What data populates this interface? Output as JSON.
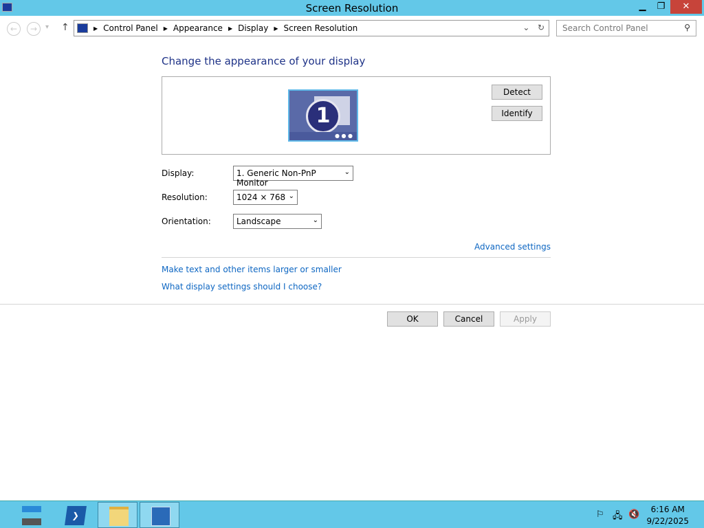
{
  "window": {
    "title": "Screen Resolution",
    "minimize": "▁",
    "restore": "❐",
    "close": "✕"
  },
  "nav": {
    "back": "←",
    "forward": "→",
    "recent": "▾",
    "up": "↑",
    "breadcrumbs": [
      "Control Panel",
      "Appearance",
      "Display",
      "Screen Resolution"
    ],
    "dropdown": "⌄",
    "refresh": "↻",
    "search_placeholder": "Search Control Panel",
    "search_icon": "⚲"
  },
  "main": {
    "heading": "Change the appearance of your display",
    "monitor_number": "1",
    "detect": "Detect",
    "identify": "Identify",
    "display_label": "Display:",
    "display_value": "1. Generic Non-PnP Monitor",
    "resolution_label": "Resolution:",
    "resolution_value": "1024 × 768",
    "orientation_label": "Orientation:",
    "orientation_value": "Landscape",
    "advanced": "Advanced settings",
    "link_text_size": "Make text and other items larger or smaller",
    "link_help": "What display settings should I choose?",
    "ok": "OK",
    "cancel": "Cancel",
    "apply": "Apply"
  },
  "taskbar": {
    "time": "6:16 AM",
    "date": "9/22/2025"
  }
}
